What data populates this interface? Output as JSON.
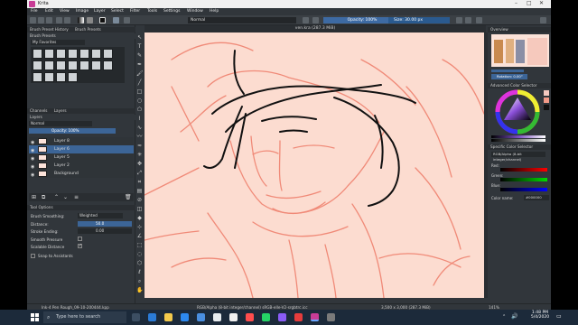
{
  "window": {
    "title": "Krita",
    "controls": [
      "–",
      "□",
      "✕"
    ]
  },
  "menu": [
    "File",
    "Edit",
    "View",
    "Image",
    "Layer",
    "Select",
    "Filter",
    "Tools",
    "Settings",
    "Window",
    "Help"
  ],
  "toolbar": {
    "blend_mode": "Normal",
    "opacity_label": "Opacity: 100%",
    "size_label": "Size: 30.00 px"
  },
  "left_dock": {
    "brush_tabs": [
      "Brush Preset History",
      "Brush Presets"
    ],
    "brush_header": "Brush Presets",
    "tag_filter": "My Favorites",
    "layers_tabs": [
      "Channels",
      "Layers"
    ],
    "layers_header": "Layers",
    "layer_mode": "Normal",
    "layer_opacity": "Opacity: 100%",
    "layers": [
      {
        "name": "Layer 8",
        "selected": false
      },
      {
        "name": "Layer 6",
        "selected": true
      },
      {
        "name": "Layer 5",
        "selected": false
      },
      {
        "name": "Layer 2",
        "selected": false
      },
      {
        "name": "Background",
        "selected": false
      }
    ],
    "tool_options_header": "Tool Options",
    "brush_smoothing_label": "Brush Smoothing:",
    "brush_smoothing_value": "Weighted",
    "distance_label": "Distance:",
    "distance_value": "50.0",
    "stroke_ending_label": "Stroke Ending:",
    "stroke_ending_value": "0.00",
    "smooth_pressure_label": "Smooth Pressure",
    "scalable_distance_label": "Scalable Distance",
    "snap_label": "Snap to Assistants"
  },
  "canvas_tab": "ven.kra (287.3 MiB)",
  "status": {
    "brush": "Ink-4 Pen Rough_09-10-200444.kpp",
    "color_space": "RGB/Alpha (8-bit integer/channel) sRGB-elle-V2-srgbtrc.icc",
    "image_size": "3,500 x 3,000 (287.3 MiB)",
    "zoom": "141%"
  },
  "right_dock": {
    "overview_header": "Overview",
    "rotation_label": "Rotation: 0.00°",
    "advanced_color_header": "Advanced Color Selector",
    "specific_color_header": "Specific Color Selector",
    "specific_color_mode": "RGB/Alpha (8-bit integer/channel)",
    "channels": [
      "Red:",
      "Green:",
      "Blue:"
    ],
    "color_name_label": "Color name:",
    "color_name_value": "#000000"
  },
  "taskbar": {
    "search_placeholder": "Type here to search",
    "time": "1:48 PM",
    "date": "5/4/2020"
  }
}
